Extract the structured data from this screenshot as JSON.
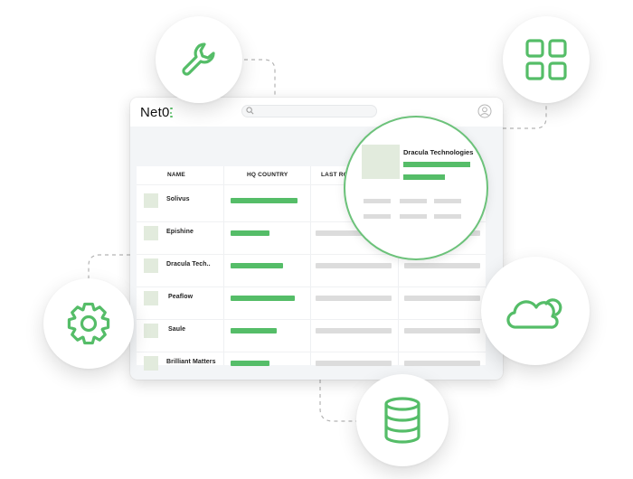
{
  "app": {
    "logo_text": "Net0"
  },
  "table": {
    "columns": [
      "NAME",
      "HQ COUNTRY",
      "LAST RO"
    ],
    "rows": [
      {
        "name": "Solivus",
        "hq_fill": 0.8
      },
      {
        "name": "Epishine",
        "hq_fill": 0.47
      },
      {
        "name": "Dracula Tech..",
        "hq_fill": 0.63
      },
      {
        "name": "Peaflow",
        "hq_fill": 0.77
      },
      {
        "name": "Saule",
        "hq_fill": 0.55
      },
      {
        "name": "Brilliant Matters",
        "hq_fill": 0.47
      }
    ]
  },
  "magnifier": {
    "company_name": "Dracula Technologies"
  },
  "icons": [
    "wrench-icon",
    "grid-icon",
    "gear-icon",
    "cloud-icon",
    "database-icon",
    "search-icon",
    "user-icon"
  ],
  "colors": {
    "accent": "#55bd68",
    "placeholder": "#dcdcdc",
    "thumb": "#e2ebdd"
  }
}
